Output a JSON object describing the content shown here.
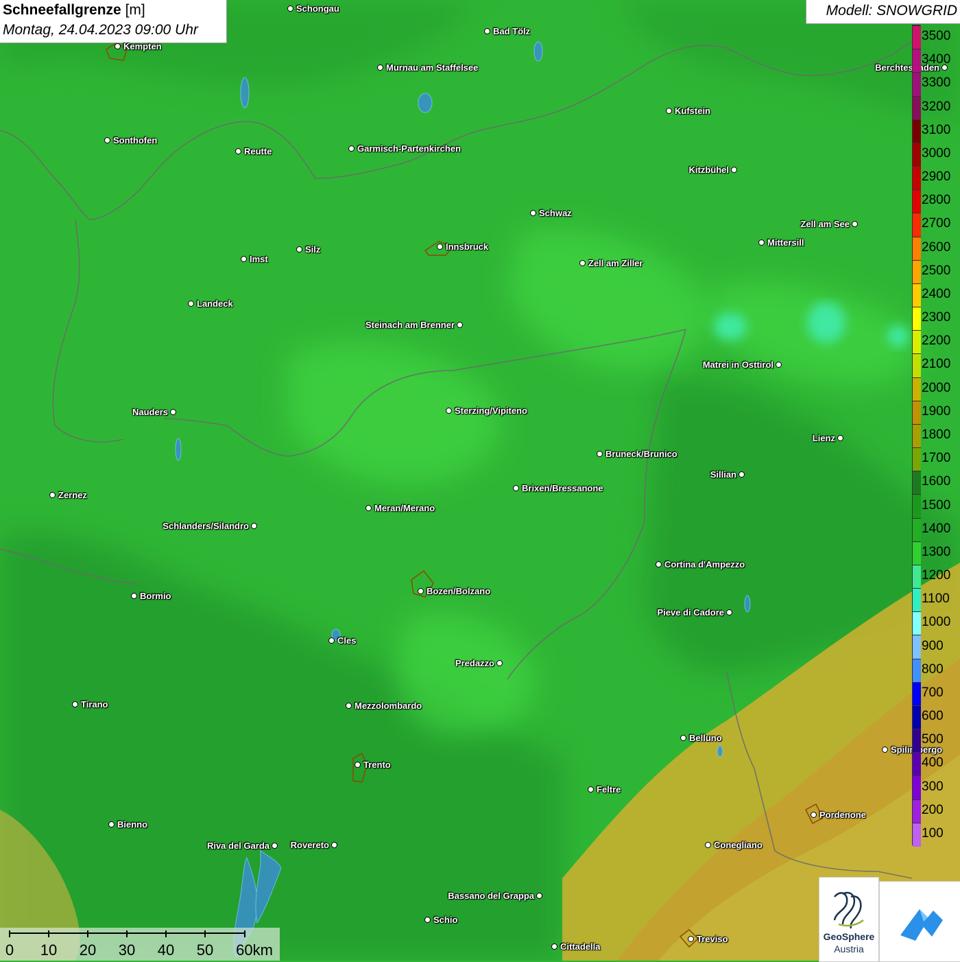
{
  "title": "Schneefallgrenze",
  "unit": "[m]",
  "datetime": "Montag, 24.04.2023 09:00 Uhr",
  "model": "Modell: SNOWGRID",
  "legend": [
    {
      "label": "3500",
      "color": "#d0106a"
    },
    {
      "label": "3400",
      "color": "#b80e80"
    },
    {
      "label": "3300",
      "color": "#a0107a"
    },
    {
      "label": "3200",
      "color": "#8a0e5a"
    },
    {
      "label": "3100",
      "color": "#7a0000"
    },
    {
      "label": "3000",
      "color": "#a00000"
    },
    {
      "label": "2900",
      "color": "#c80000"
    },
    {
      "label": "2800",
      "color": "#e40000"
    },
    {
      "label": "2700",
      "color": "#ff2a00"
    },
    {
      "label": "2600",
      "color": "#ff7f00"
    },
    {
      "label": "2500",
      "color": "#ffa500"
    },
    {
      "label": "2400",
      "color": "#ffcc00"
    },
    {
      "label": "2300",
      "color": "#ffff00"
    },
    {
      "label": "2200",
      "color": "#d8f000"
    },
    {
      "label": "2100",
      "color": "#c0e000"
    },
    {
      "label": "2000",
      "color": "#c8b400"
    },
    {
      "label": "1900",
      "color": "#c09400"
    },
    {
      "label": "1800",
      "color": "#a8a000"
    },
    {
      "label": "1700",
      "color": "#78a800"
    },
    {
      "label": "1600",
      "color": "#1e7a1e"
    },
    {
      "label": "1500",
      "color": "#1a9a1a"
    },
    {
      "label": "1400",
      "color": "#22b022"
    },
    {
      "label": "1300",
      "color": "#30d030"
    },
    {
      "label": "1200",
      "color": "#40e890"
    },
    {
      "label": "1100",
      "color": "#30f0c0"
    },
    {
      "label": "1000",
      "color": "#80ffff"
    },
    {
      "label": "900",
      "color": "#80c0ff"
    },
    {
      "label": "800",
      "color": "#4090ff"
    },
    {
      "label": "700",
      "color": "#0000ff"
    },
    {
      "label": "600",
      "color": "#0000b0"
    },
    {
      "label": "500",
      "color": "#300090"
    },
    {
      "label": "400",
      "color": "#5a00b0"
    },
    {
      "label": "300",
      "color": "#8000d8"
    },
    {
      "label": "200",
      "color": "#a020e0"
    },
    {
      "label": "100",
      "color": "#c060f0"
    }
  ],
  "cities": [
    {
      "name": "Schongau",
      "side": "right"
    },
    {
      "name": "Bad Tölz",
      "side": "right"
    },
    {
      "name": "Kempten",
      "side": "right"
    },
    {
      "name": "Murnau am Staffelsee",
      "side": "right"
    },
    {
      "name": "Berchtesgaden",
      "side": "left"
    },
    {
      "name": "Kufstein",
      "side": "right"
    },
    {
      "name": "Sonthofen",
      "side": "right"
    },
    {
      "name": "Reutte",
      "side": "right"
    },
    {
      "name": "Garmisch-Partenkirchen",
      "side": "right"
    },
    {
      "name": "Kitzbühel",
      "side": "left"
    },
    {
      "name": "Schwaz",
      "side": "right"
    },
    {
      "name": "Zell am See",
      "side": "left"
    },
    {
      "name": "Innsbruck",
      "side": "right"
    },
    {
      "name": "Imst",
      "side": "right"
    },
    {
      "name": "Silz",
      "side": "right"
    },
    {
      "name": "Zell am Ziller",
      "side": "right"
    },
    {
      "name": "Mittersill",
      "side": "right"
    },
    {
      "name": "Landeck",
      "side": "right"
    },
    {
      "name": "Steinach am Brenner",
      "side": "left"
    },
    {
      "name": "Matrei in Osttirol",
      "side": "left"
    },
    {
      "name": "Nauders",
      "side": "left"
    },
    {
      "name": "Sterzing/Vipiteno",
      "side": "right"
    },
    {
      "name": "Lienz",
      "side": "left"
    },
    {
      "name": "Bruneck/Brunico",
      "side": "right"
    },
    {
      "name": "Sillian",
      "side": "left"
    },
    {
      "name": "Zernez",
      "side": "right"
    },
    {
      "name": "Brixen/Bressanone",
      "side": "right"
    },
    {
      "name": "Meran/Merano",
      "side": "right"
    },
    {
      "name": "Schlanders/Silandro",
      "side": "left"
    },
    {
      "name": "Cortina d'Ampezzo",
      "side": "right"
    },
    {
      "name": "Bozen/Bolzano",
      "side": "right"
    },
    {
      "name": "Bormio",
      "side": "right"
    },
    {
      "name": "Pieve di Cadore",
      "side": "left"
    },
    {
      "name": "Cles",
      "side": "right"
    },
    {
      "name": "Predazzo",
      "side": "left"
    },
    {
      "name": "Tirano",
      "side": "right"
    },
    {
      "name": "Mezzolombardo",
      "side": "right"
    },
    {
      "name": "Belluno",
      "side": "right"
    },
    {
      "name": "Spilimbergo",
      "side": "right"
    },
    {
      "name": "Trento",
      "side": "right"
    },
    {
      "name": "Feltre",
      "side": "right"
    },
    {
      "name": "Pordenone",
      "side": "right"
    },
    {
      "name": "Bienno",
      "side": "right"
    },
    {
      "name": "Riva del Garda",
      "side": "left"
    },
    {
      "name": "Rovereto",
      "side": "left"
    },
    {
      "name": "Conegliano",
      "side": "right"
    },
    {
      "name": "Bassano del Grappa",
      "side": "left"
    },
    {
      "name": "Schio",
      "side": "right"
    },
    {
      "name": "Treviso",
      "side": "right"
    },
    {
      "name": "Cittadella",
      "side": "right"
    }
  ],
  "scale": [
    "0",
    "10",
    "20",
    "30",
    "40",
    "50",
    "60km"
  ],
  "logos": {
    "geosphere_line1": "GeoSphere",
    "geosphere_line2": "Austria"
  },
  "colors": {
    "land_green": "#2fb535",
    "dark_green": "#1f8f2a",
    "light_green": "#3fd33f",
    "south_yellow": "#c8b030",
    "south_orange": "#c89a30"
  }
}
